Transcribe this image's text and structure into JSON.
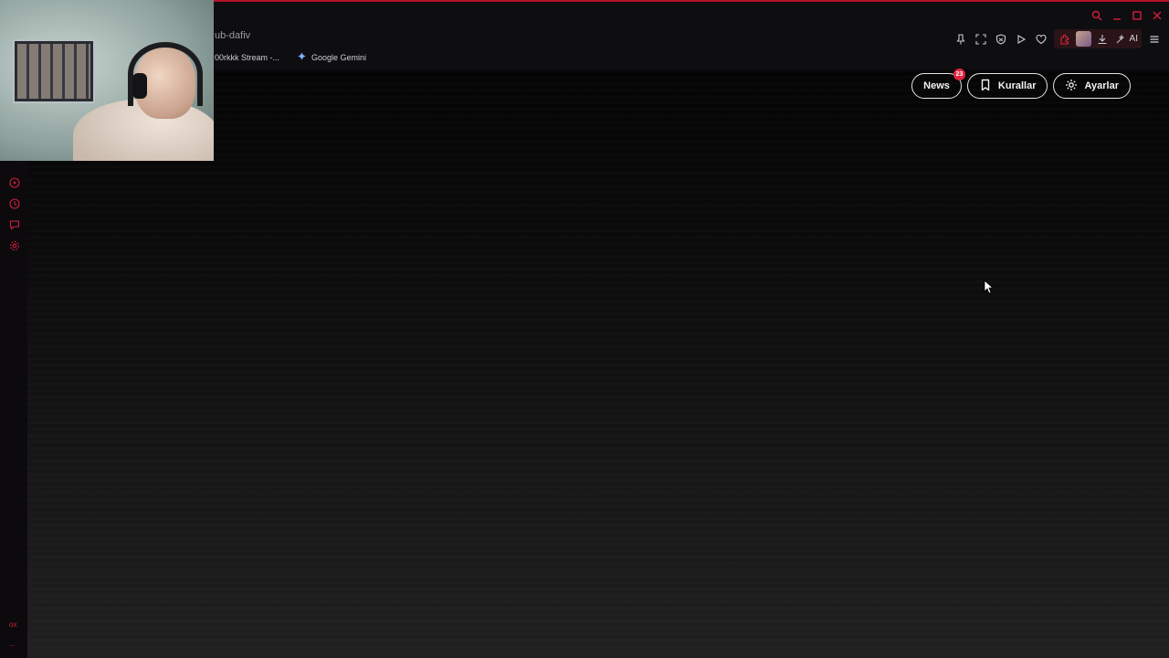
{
  "browser": {
    "url_fragment": "ub-dafiv",
    "bookmarks": [
      {
        "label": "00rkkk Stream -..."
      },
      {
        "label": "Google Gemini"
      }
    ],
    "ai_label": "AI",
    "accent_color": "#e3243f"
  },
  "header_buttons": {
    "news_label": "News",
    "news_badge": "23",
    "rules_label": "Kurallar",
    "settings_label": "Ayarlar"
  },
  "left_rail": {
    "bottom_text": "ox",
    "bottom_more": "..."
  }
}
